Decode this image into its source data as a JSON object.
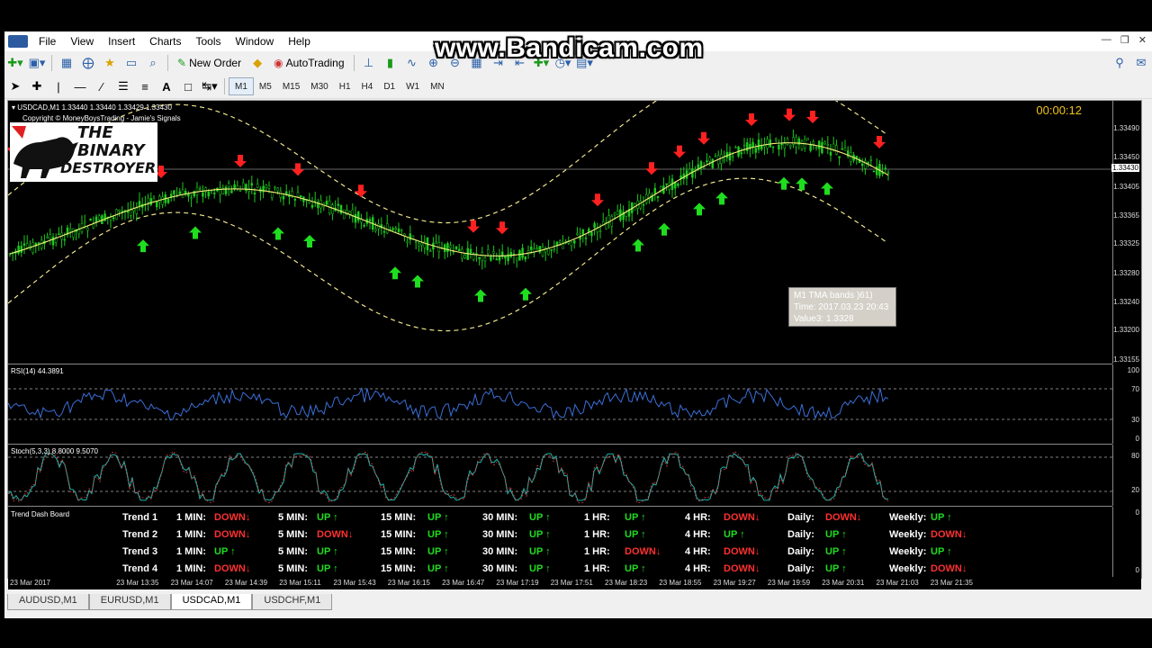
{
  "watermark": "www.Bandicam.com",
  "menu": [
    "File",
    "View",
    "Insert",
    "Charts",
    "Tools",
    "Window",
    "Help"
  ],
  "toolbar": {
    "new_order": "New Order",
    "autotrading": "AutoTrading",
    "timeframes": [
      "M1",
      "M5",
      "M15",
      "M30",
      "H1",
      "H4",
      "D1",
      "W1",
      "MN"
    ]
  },
  "chart": {
    "header": "USDCAD,M1  1.33440 1.33440 1.33429 1.33430",
    "copyright": "Copyright © MoneyBoysTrading - Jamie's Signals",
    "timer": "00:00:12",
    "logo_line1": "THE BINARY",
    "logo_line2": "DESTROYER",
    "current_price": "1.33430",
    "price_ticks": [
      "1.33490",
      "1.33450",
      "1.33405",
      "1.33365",
      "1.33325",
      "1.33280",
      "1.33240",
      "1.33200",
      "1.33155"
    ],
    "tooltip": {
      "line1": "M1 TMA bands )61)",
      "line2": "Time: 2017.03.23 20:43",
      "line3": "Value3: 1.3328"
    },
    "arrow_color_up": "#1fdd1f",
    "arrow_color_down": "#ff2020"
  },
  "rsi": {
    "label": "RSI(14) 44.3891",
    "ticks": [
      "100",
      "70",
      "30",
      "0"
    ]
  },
  "stoch": {
    "label": "Stoch(5,3,3) 8.8000 9.5070",
    "ticks": [
      "80",
      "20"
    ]
  },
  "dashboard": {
    "title": "Trend Dash Board",
    "zero_label": "0",
    "rows": [
      {
        "name": "Trend 1",
        "cols": [
          [
            "1 MIN:",
            "DOWN↓",
            "down"
          ],
          [
            "5 MIN:",
            "UP ↑",
            "up"
          ],
          [
            "15 MIN:",
            "UP ↑",
            "up"
          ],
          [
            "30 MIN:",
            "UP ↑",
            "up"
          ],
          [
            "1 HR:",
            "UP ↑",
            "up"
          ],
          [
            "4 HR:",
            "DOWN↓",
            "down"
          ],
          [
            "Daily:",
            "DOWN↓",
            "down"
          ],
          [
            "Weekly:",
            "UP ↑",
            "up"
          ]
        ]
      },
      {
        "name": "Trend 2",
        "cols": [
          [
            "1 MIN:",
            "DOWN↓",
            "down"
          ],
          [
            "5 MIN:",
            "DOWN↓",
            "down"
          ],
          [
            "15 MIN:",
            "UP ↑",
            "up"
          ],
          [
            "30 MIN:",
            "UP ↑",
            "up"
          ],
          [
            "1 HR:",
            "UP ↑",
            "up"
          ],
          [
            "4 HR:",
            "UP ↑",
            "up"
          ],
          [
            "Daily:",
            "UP ↑",
            "up"
          ],
          [
            "Weekly:",
            "DOWN↓",
            "down"
          ]
        ]
      },
      {
        "name": "Trend 3",
        "cols": [
          [
            "1 MIN:",
            "UP ↑",
            "up"
          ],
          [
            "5 MIN:",
            "UP ↑",
            "up"
          ],
          [
            "15 MIN:",
            "UP ↑",
            "up"
          ],
          [
            "30 MIN:",
            "UP ↑",
            "up"
          ],
          [
            "1 HR:",
            "DOWN↓",
            "down"
          ],
          [
            "4 HR:",
            "DOWN↓",
            "down"
          ],
          [
            "Daily:",
            "UP ↑",
            "up"
          ],
          [
            "Weekly:",
            "UP ↑",
            "up"
          ]
        ]
      },
      {
        "name": "Trend 4",
        "cols": [
          [
            "1 MIN:",
            "DOWN↓",
            "down"
          ],
          [
            "5 MIN:",
            "UP ↑",
            "up"
          ],
          [
            "15 MIN:",
            "UP ↑",
            "up"
          ],
          [
            "30 MIN:",
            "UP ↑",
            "up"
          ],
          [
            "1 HR:",
            "UP ↑",
            "up"
          ],
          [
            "4 HR:",
            "DOWN↓",
            "down"
          ],
          [
            "Daily:",
            "UP ↑",
            "up"
          ],
          [
            "Weekly:",
            "DOWN↓",
            "down"
          ]
        ]
      }
    ]
  },
  "time_labels": [
    "23 Mar 2017",
    "23 Mar 13:35",
    "23 Mar 14:07",
    "23 Mar 14:39",
    "23 Mar 15:11",
    "23 Mar 15:43",
    "23 Mar 16:15",
    "23 Mar 16:47",
    "23 Mar 17:19",
    "23 Mar 17:51",
    "23 Mar 18:23",
    "23 Mar 18:55",
    "23 Mar 19:27",
    "23 Mar 19:59",
    "23 Mar 20:31",
    "23 Mar 21:03",
    "23 Mar 21:35"
  ],
  "tabs": [
    "AUDUSD,M1",
    "EURUSD,M1",
    "USDCAD,M1",
    "USDCHF,M1"
  ],
  "active_tab": "USDCAD,M1"
}
